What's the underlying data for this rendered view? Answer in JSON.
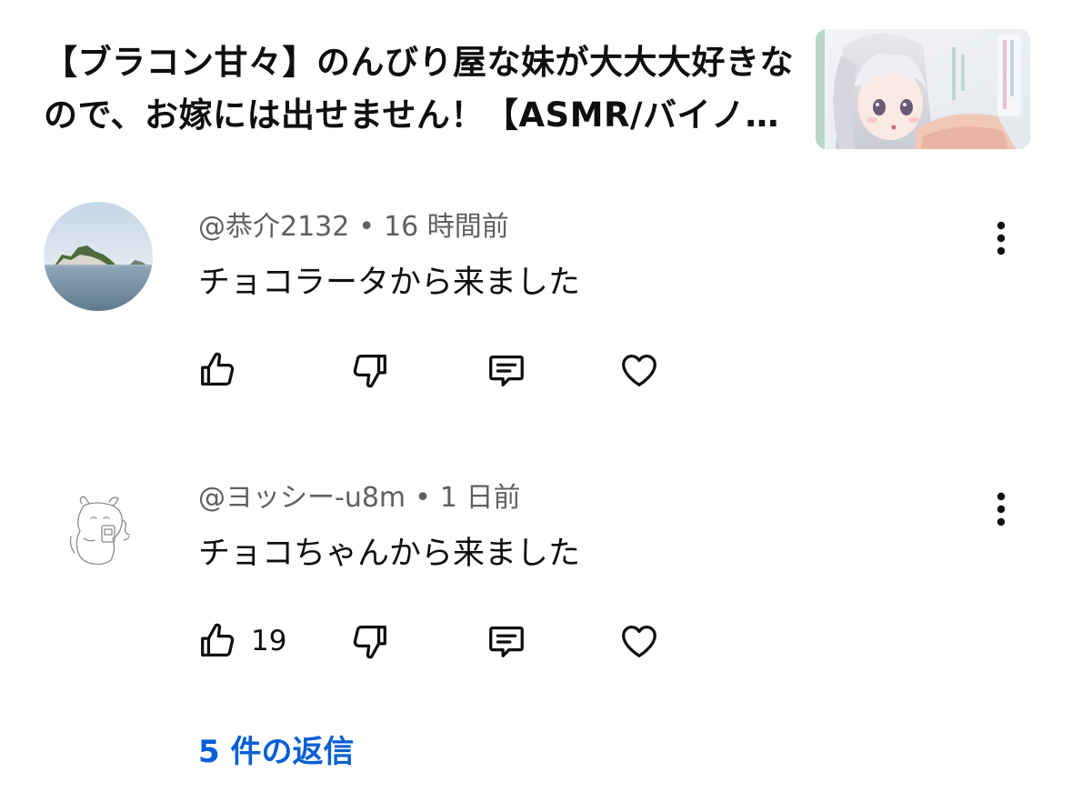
{
  "video": {
    "title": "【ブラコン甘々】のんびり屋な妹が大大大好きなので、お嫁には出せません！【ASMR/バイノーラル】",
    "thumbnail_icon": "anime-girl-thumbnail"
  },
  "comments": [
    {
      "author": "@恭介2132",
      "separator": "•",
      "time": "16 時間前",
      "text": "チョコラータから来ました",
      "avatar_icon": "island-photo-avatar",
      "like_count": ""
    },
    {
      "author": "@ヨッシー-u8m",
      "separator": "•",
      "time": "1 日前",
      "text": "チョコちゃんから来ました",
      "avatar_icon": "sketch-avatar",
      "like_count": "19"
    }
  ],
  "replies": {
    "label": "5 件の返信"
  },
  "colors": {
    "text_primary": "#0f0f0f",
    "text_secondary": "#606060",
    "link": "#065fd4"
  }
}
